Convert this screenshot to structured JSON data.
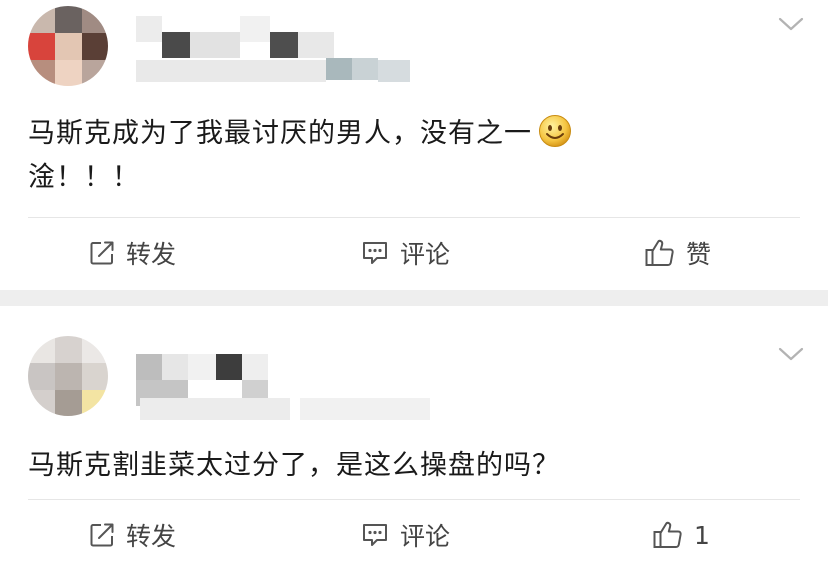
{
  "posts": [
    {
      "content_lines": [
        "马斯克成为了我最讨厌的男人，没有之一",
        "淦！！！"
      ],
      "actions": {
        "repost": "转发",
        "comment": "评论",
        "like": "赞"
      }
    },
    {
      "content_lines": [
        "马斯克割韭菜太过分了，是这么操盘的吗？"
      ],
      "actions": {
        "repost": "转发",
        "comment": "评论",
        "like": "1"
      }
    }
  ],
  "icons": {
    "expand": "chevron-down-icon",
    "repost": "repost-icon",
    "comment": "comment-icon",
    "like": "thumbs-up-icon",
    "emoji": "smile-emoji-icon"
  },
  "colors": {
    "separator": "#eeeeee",
    "divider": "#e6e6e6",
    "action_text": "#444444",
    "emoji": "#f5c542"
  }
}
